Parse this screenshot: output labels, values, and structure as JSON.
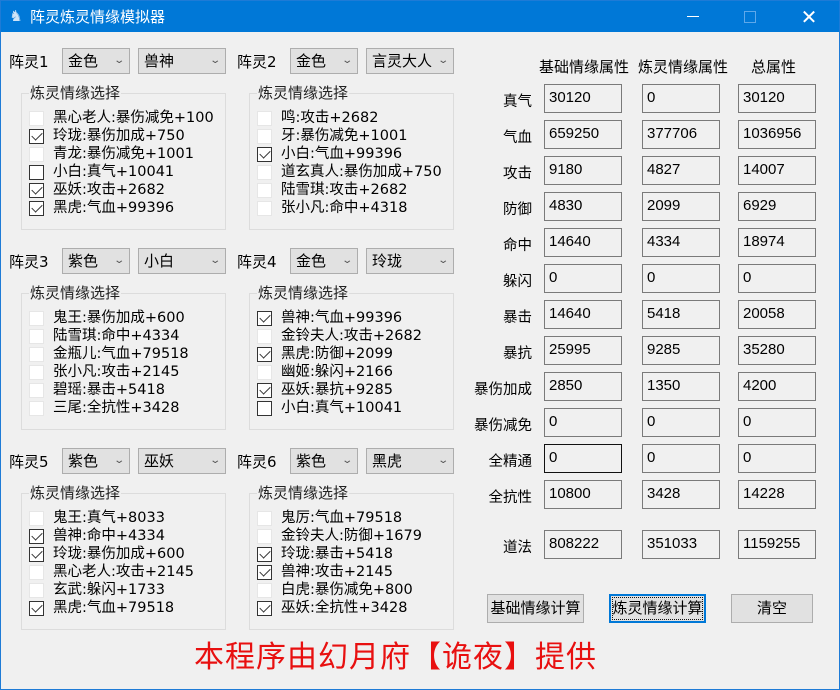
{
  "window": {
    "title": "阵灵炼灵情缘模拟器",
    "app_icon": "deer-icon",
    "controls": {
      "minimize": "minimize",
      "maximize": "maximize",
      "close": "✕"
    }
  },
  "zhenling": [
    {
      "label": "阵灵1",
      "quality": "金色",
      "spirit": "兽神",
      "group_title": "炼灵情缘选择",
      "options": [
        {
          "text": "黑心老人:暴伤减免+100",
          "checked": false,
          "enabled": false
        },
        {
          "text": "玲珑:暴伤加成+750",
          "checked": true,
          "enabled": true
        },
        {
          "text": "青龙:暴伤减免+1001",
          "checked": false,
          "enabled": false
        },
        {
          "text": "小白:真气+10041",
          "checked": false,
          "enabled": true
        },
        {
          "text": "巫妖:攻击+2682",
          "checked": true,
          "enabled": true
        },
        {
          "text": "黑虎:气血+99396",
          "checked": true,
          "enabled": true
        }
      ]
    },
    {
      "label": "阵灵2",
      "quality": "金色",
      "spirit": "言灵大人",
      "group_title": "炼灵情缘选择",
      "options": [
        {
          "text": "鸣:攻击+2682",
          "checked": false,
          "enabled": false
        },
        {
          "text": "牙:暴伤减免+1001",
          "checked": false,
          "enabled": false
        },
        {
          "text": "小白:气血+99396",
          "checked": true,
          "enabled": true
        },
        {
          "text": "道玄真人:暴伤加成+750",
          "checked": false,
          "enabled": false
        },
        {
          "text": "陆雪琪:攻击+2682",
          "checked": false,
          "enabled": false
        },
        {
          "text": "张小凡:命中+4318",
          "checked": false,
          "enabled": false
        }
      ]
    },
    {
      "label": "阵灵3",
      "quality": "紫色",
      "spirit": "小白",
      "group_title": "炼灵情缘选择",
      "options": [
        {
          "text": "鬼王:暴伤加成+600",
          "checked": false,
          "enabled": false
        },
        {
          "text": "陆雪琪:命中+4334",
          "checked": false,
          "enabled": false
        },
        {
          "text": "金瓶儿:气血+79518",
          "checked": false,
          "enabled": false
        },
        {
          "text": "张小凡:攻击+2145",
          "checked": false,
          "enabled": false
        },
        {
          "text": "碧瑶:暴击+5418",
          "checked": false,
          "enabled": false
        },
        {
          "text": "三尾:全抗性+3428",
          "checked": false,
          "enabled": false
        }
      ]
    },
    {
      "label": "阵灵4",
      "quality": "金色",
      "spirit": "玲珑",
      "group_title": "炼灵情缘选择",
      "options": [
        {
          "text": "兽神:气血+99396",
          "checked": true,
          "enabled": true
        },
        {
          "text": "金铃夫人:攻击+2682",
          "checked": false,
          "enabled": false
        },
        {
          "text": "黑虎:防御+2099",
          "checked": true,
          "enabled": true
        },
        {
          "text": "幽姬:躲闪+2166",
          "checked": false,
          "enabled": false
        },
        {
          "text": "巫妖:暴抗+9285",
          "checked": true,
          "enabled": true
        },
        {
          "text": "小白:真气+10041",
          "checked": false,
          "enabled": true
        }
      ]
    },
    {
      "label": "阵灵5",
      "quality": "紫色",
      "spirit": "巫妖",
      "group_title": "炼灵情缘选择",
      "options": [
        {
          "text": "鬼王:真气+8033",
          "checked": false,
          "enabled": false
        },
        {
          "text": "兽神:命中+4334",
          "checked": true,
          "enabled": true
        },
        {
          "text": "玲珑:暴伤加成+600",
          "checked": true,
          "enabled": true
        },
        {
          "text": "黑心老人:攻击+2145",
          "checked": false,
          "enabled": false
        },
        {
          "text": "玄武:躲闪+1733",
          "checked": false,
          "enabled": false
        },
        {
          "text": "黑虎:气血+79518",
          "checked": true,
          "enabled": true
        }
      ]
    },
    {
      "label": "阵灵6",
      "quality": "紫色",
      "spirit": "黑虎",
      "group_title": "炼灵情缘选择",
      "options": [
        {
          "text": "鬼厉:气血+79518",
          "checked": false,
          "enabled": false
        },
        {
          "text": "金铃夫人:防御+1679",
          "checked": false,
          "enabled": false
        },
        {
          "text": "玲珑:暴击+5418",
          "checked": true,
          "enabled": true
        },
        {
          "text": "兽神:攻击+2145",
          "checked": true,
          "enabled": true
        },
        {
          "text": "白虎:暴伤减免+800",
          "checked": false,
          "enabled": false
        },
        {
          "text": "巫妖:全抗性+3428",
          "checked": true,
          "enabled": true
        }
      ]
    }
  ],
  "stats": {
    "headers": [
      "基础情缘属性",
      "炼灵情缘属性",
      "总属性"
    ],
    "rows": [
      {
        "label": "真气",
        "values": [
          "30120",
          "0",
          "30120"
        ]
      },
      {
        "label": "气血",
        "values": [
          "659250",
          "377706",
          "1036956"
        ]
      },
      {
        "label": "攻击",
        "values": [
          "9180",
          "4827",
          "14007"
        ]
      },
      {
        "label": "防御",
        "values": [
          "4830",
          "2099",
          "6929"
        ]
      },
      {
        "label": "命中",
        "values": [
          "14640",
          "4334",
          "18974"
        ]
      },
      {
        "label": "躲闪",
        "values": [
          "0",
          "0",
          "0"
        ]
      },
      {
        "label": "暴击",
        "values": [
          "14640",
          "5418",
          "20058"
        ]
      },
      {
        "label": "暴抗",
        "values": [
          "25995",
          "9285",
          "35280"
        ]
      },
      {
        "label": "暴伤加成",
        "values": [
          "2850",
          "1350",
          "4200"
        ]
      },
      {
        "label": "暴伤减免",
        "values": [
          "0",
          "0",
          "0"
        ]
      },
      {
        "label": "全精通",
        "values": [
          "0",
          "0",
          "0"
        ]
      },
      {
        "label": "全抗性",
        "values": [
          "10800",
          "3428",
          "14228"
        ]
      },
      {
        "label": "道法",
        "values": [
          "808222",
          "351033",
          "1159255"
        ]
      }
    ]
  },
  "buttons": {
    "base_calc": "基础情缘计算",
    "refine_calc": "炼灵情缘计算",
    "clear": "清空"
  },
  "footer": "本程序由幻月府【诡夜】提供"
}
